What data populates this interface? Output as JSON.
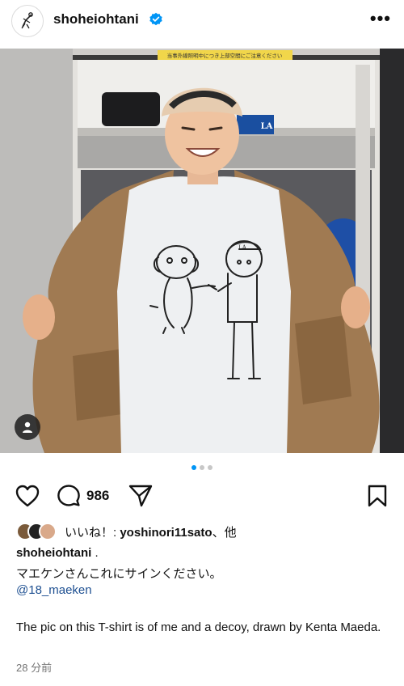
{
  "header": {
    "username": "shoheiohtani",
    "verified_icon": "verified-badge-icon",
    "more_icon": "more-options-icon",
    "more_label": "•••"
  },
  "photo": {
    "sign_text": "当事外線照明中につき上部空間にご注意ください",
    "cap_logo": "LA",
    "box_logo": "LA",
    "tag_icon": "person-tag-icon"
  },
  "carousel": {
    "count": 3,
    "active": 1
  },
  "actions": {
    "like_icon": "heart-icon",
    "comment_icon": "comment-icon",
    "comment_count": "986",
    "share_icon": "send-icon",
    "save_icon": "bookmark-icon"
  },
  "likes": {
    "prefix": "いいね！: ",
    "user": "yoshinori11sato",
    "suffix": "、他"
  },
  "caption": {
    "username": "shoheiohtani",
    "dot": " .",
    "line_jp": "マエケンさんこれにサインください。",
    "mention": "@18_maeken",
    "line_en": "The pic on this T-shirt is of me and a decoy, drawn by Kenta Maeda."
  },
  "timestamp": "28 分前",
  "colors": {
    "accent": "#0095f6",
    "verified": "#0095f6",
    "mention": "#1d4f91",
    "muted": "#737373"
  }
}
